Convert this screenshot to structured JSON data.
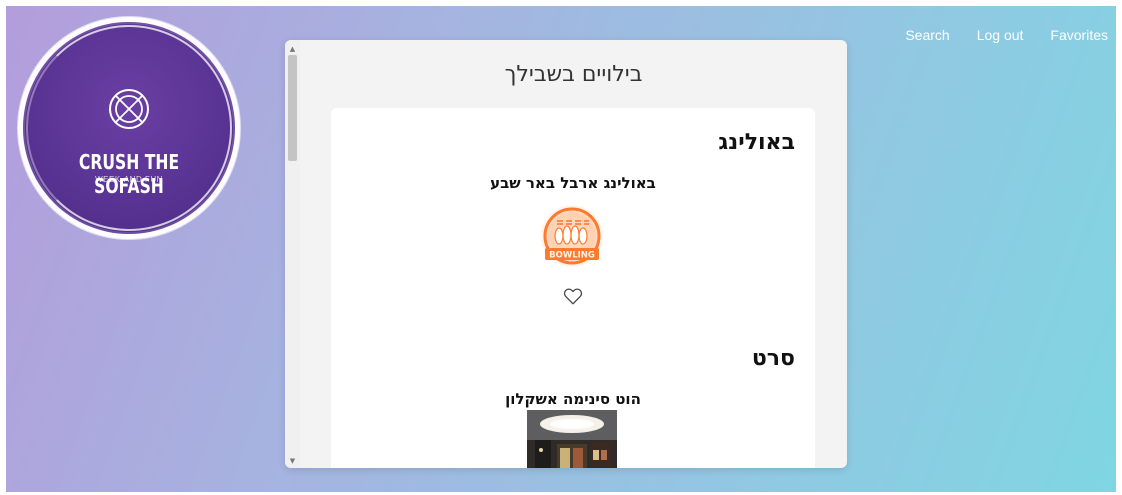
{
  "nav": {
    "items": [
      {
        "label": "Search"
      },
      {
        "label": "Log out"
      },
      {
        "label": "Favorites"
      }
    ]
  },
  "logo": {
    "title": "CRUSH THE SOFASH",
    "subtitle": "WEEK-AND FUN",
    "icon": "globe-icon"
  },
  "panel": {
    "title": "בילויים בשבילך",
    "categories": [
      {
        "heading": "באולינג",
        "place_name": "באולינג ארבל באר שבע",
        "image_label": "BOWLING",
        "image_icon": "bowling-neon-icon",
        "favorite_icon": "heart-outline-icon"
      },
      {
        "heading": "סרט",
        "place_name": "הוט סינימה אשקלון",
        "image_icon": "cinema-photo"
      }
    ]
  },
  "colors": {
    "bg_start": "#b39ddb",
    "bg_end": "#7fd6e2",
    "logo_purple": "#5a3494",
    "bowling_orange": "#ff7a2e"
  }
}
